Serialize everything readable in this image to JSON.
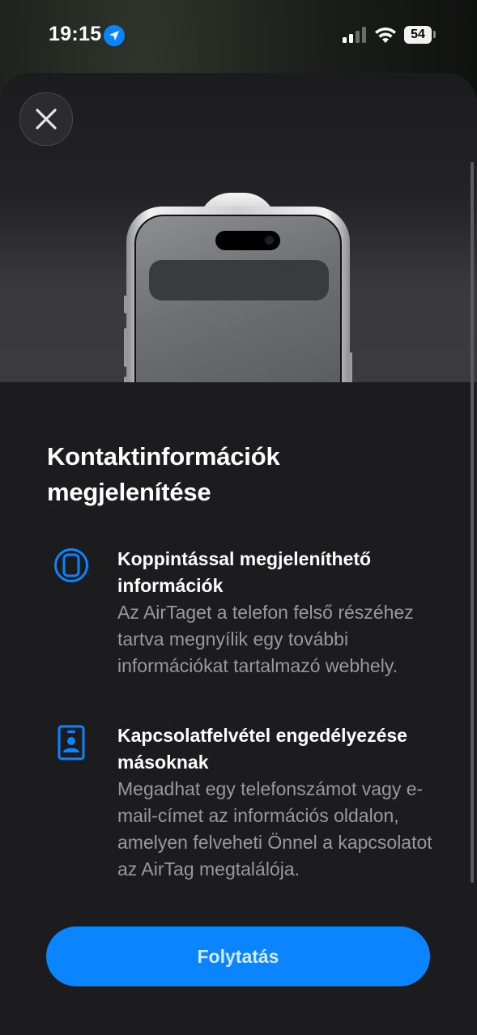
{
  "status_bar": {
    "time": "19:15",
    "battery": "54",
    "location_icon": "location-arrow-icon",
    "signal_icon": "cellular-signal-icon",
    "wifi_icon": "wifi-icon"
  },
  "sheet": {
    "close_icon": "close-icon",
    "title": "Kontaktinformációk megjelenítése",
    "features": [
      {
        "icon": "phone-outline-icon",
        "title": "Koppintással megjeleníthető információk",
        "description": "Az AirTaget a telefon felső részéhez tartva megnyílik egy további információkat tartalmazó webhely."
      },
      {
        "icon": "contact-card-icon",
        "title": "Kapcsolatfelvétel engedélyezése másoknak",
        "description": "Megadhat egy telefonszámot vagy e-mail-címet az információs oldalon, amelyen felveheti Önnel a kapcsolatot az AirTag megtalálója."
      }
    ],
    "continue_label": "Folytatás"
  },
  "colors": {
    "accent": "#0a84ff",
    "background": "#1c1c1e",
    "secondary_text": "#98989d"
  }
}
